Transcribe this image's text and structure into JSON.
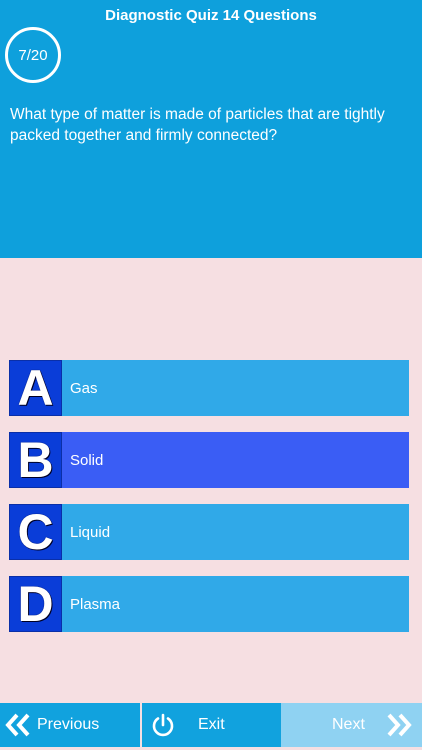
{
  "header": {
    "title": "Diagnostic Quiz 14 Questions",
    "progress": "7/20",
    "question": "What type of matter is made of particles that are tightly packed together and firmly connected?"
  },
  "answers": [
    {
      "letter": "A",
      "text": "Gas",
      "selected": false
    },
    {
      "letter": "B",
      "text": "Solid",
      "selected": true
    },
    {
      "letter": "C",
      "text": "Liquid",
      "selected": false
    },
    {
      "letter": "D",
      "text": "Plasma",
      "selected": false
    }
  ],
  "footer": {
    "previous_label": "Previous",
    "exit_label": "Exit",
    "next_label": "Next"
  },
  "icons": {
    "previous": "double-chevron-left-icon",
    "exit": "power-icon",
    "next": "double-chevron-right-icon"
  },
  "colors": {
    "header_bg": "#0ea0dc",
    "page_bg": "#f6dfe2",
    "answer_bg": "#30a9e8",
    "answer_selected_bg": "#3a5df5",
    "letter_bg": "#0a3dd8",
    "next_disabled_bg": "#8fd2f2"
  }
}
